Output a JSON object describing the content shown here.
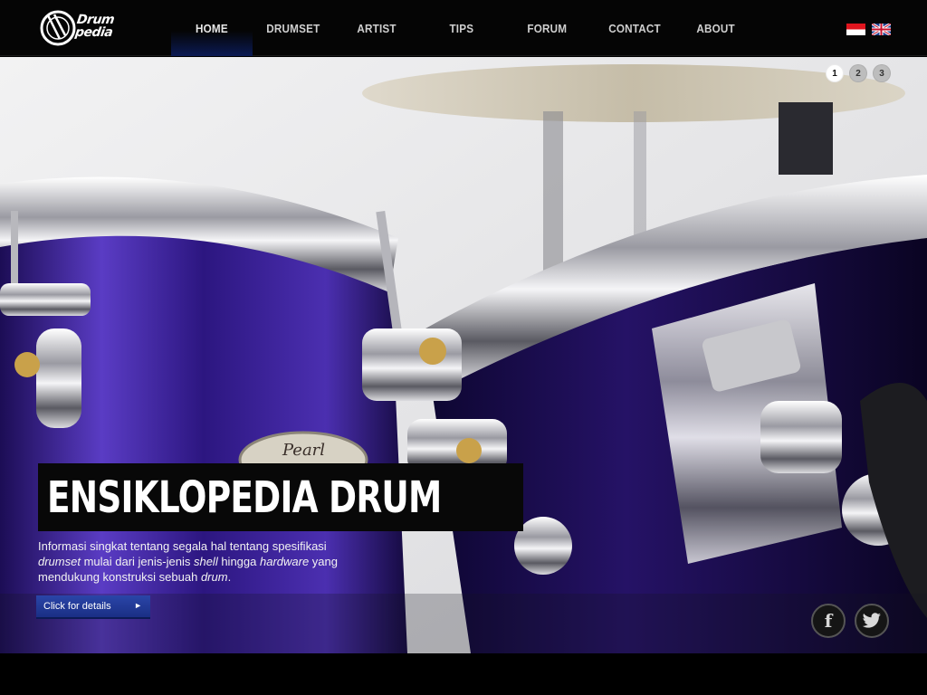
{
  "logo": {
    "text": "Drum pedia"
  },
  "nav": {
    "items": [
      {
        "label": "HOME",
        "active": true
      },
      {
        "label": "DRUMSET",
        "active": false
      },
      {
        "label": "ARTIST",
        "active": false
      },
      {
        "label": "TIPS",
        "active": false
      },
      {
        "label": "FORUM",
        "active": false
      },
      {
        "label": "CONTACT",
        "active": false
      },
      {
        "label": "ABOUT",
        "active": false
      }
    ]
  },
  "languages": [
    "indonesia-flag-icon",
    "uk-flag-icon"
  ],
  "slider": {
    "pages": [
      "1",
      "2",
      "3"
    ],
    "active_page": "1"
  },
  "hero": {
    "title": "ENSIKLOPEDIA DRUM",
    "desc_1": "Informasi singkat tentang segala hal tentang spesifikasi",
    "desc_2a": "drumset",
    "desc_2b": " mulai dari jenis-jenis ",
    "desc_2c": "shell",
    "desc_2d": " hingga ",
    "desc_2e": "hardware",
    "desc_2f": " yang",
    "desc_3a": "mendukung konstruksi sebuah ",
    "desc_3b": "drum",
    "desc_3c": ".",
    "cta_label": "Click for details",
    "cta_arrow": "►",
    "drum_badge": "Pearl"
  },
  "social": {
    "facebook": "f",
    "twitter": "t"
  },
  "colors": {
    "accent_blue": "#1f3a99",
    "drum_purple": "#3a1f8a",
    "header_bg": "#050505"
  }
}
